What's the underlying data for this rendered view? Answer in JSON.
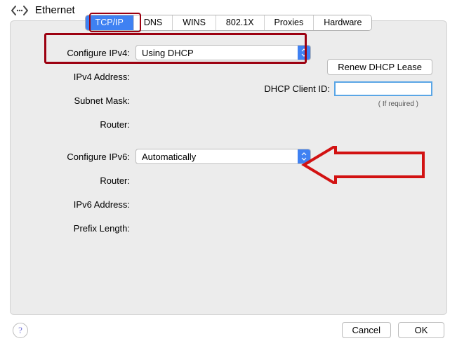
{
  "header": {
    "title": "Ethernet"
  },
  "tabs": [
    "TCP/IP",
    "DNS",
    "WINS",
    "802.1X",
    "Proxies",
    "Hardware"
  ],
  "active_tab_index": 0,
  "form": {
    "configure_ipv4_label": "Configure IPv4:",
    "configure_ipv4_value": "Using DHCP",
    "ipv4_address_label": "IPv4 Address:",
    "subnet_mask_label": "Subnet Mask:",
    "router_label": "Router:",
    "configure_ipv6_label": "Configure IPv6:",
    "configure_ipv6_value": "Automatically",
    "router2_label": "Router:",
    "ipv6_address_label": "IPv6 Address:",
    "prefix_length_label": "Prefix Length:",
    "renew_dhcp_label": "Renew DHCP Lease",
    "dhcp_client_id_label": "DHCP Client ID:",
    "dhcp_client_id_value": "",
    "if_required_label": "( If required )"
  },
  "footer": {
    "help": "?",
    "cancel": "Cancel",
    "ok": "OK"
  },
  "colors": {
    "accent": "#3f81f2",
    "annotation": "#9c0010",
    "input_focus": "#5aa6e6"
  }
}
